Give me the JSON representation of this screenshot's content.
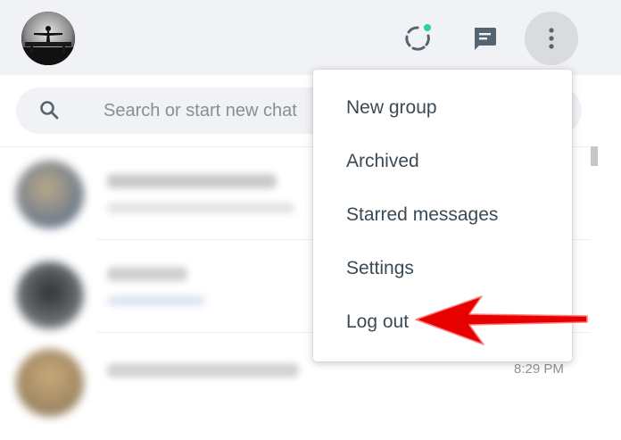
{
  "header": {
    "icons": [
      "avatar",
      "status-icon",
      "new-chat-icon",
      "more-options-icon"
    ],
    "status_dot_color": "#25d3a6"
  },
  "search": {
    "placeholder": "Search or start new chat"
  },
  "menu": {
    "items": [
      {
        "label": "New group"
      },
      {
        "label": "Archived"
      },
      {
        "label": "Starred messages"
      },
      {
        "label": "Settings"
      },
      {
        "label": "Log out"
      }
    ]
  },
  "chats": [
    {
      "time": ""
    },
    {
      "time": ""
    },
    {
      "time": "8:29 PM"
    }
  ],
  "annotation": {
    "arrow_color": "#e60000",
    "points_to": "Log out"
  }
}
